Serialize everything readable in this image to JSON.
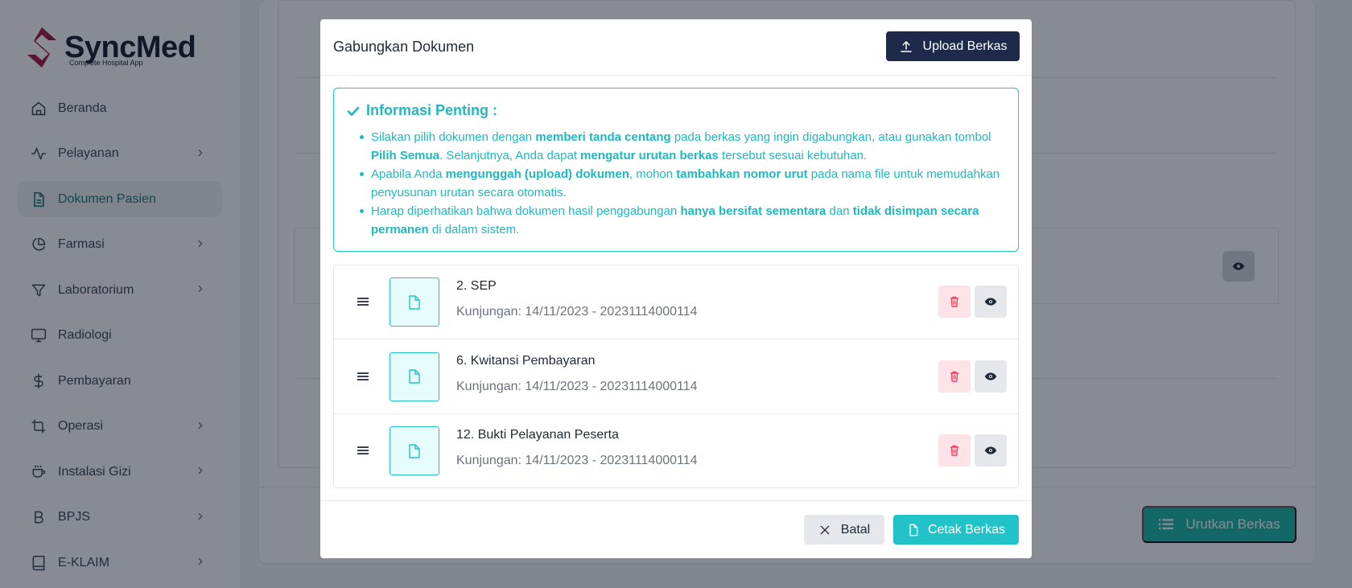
{
  "app": {
    "logo_name": "SyncMed",
    "logo_tagline": "Complete Hospital App"
  },
  "sidebar": {
    "items": [
      {
        "label": "Beranda",
        "icon": "home-icon",
        "has_children": false,
        "active": false
      },
      {
        "label": "Pelayanan",
        "icon": "activity-icon",
        "has_children": true,
        "active": false
      },
      {
        "label": "Dokumen Pasien",
        "icon": "document-icon",
        "has_children": false,
        "active": true
      },
      {
        "label": "Farmasi",
        "icon": "pie-chart-icon",
        "has_children": true,
        "active": false
      },
      {
        "label": "Laboratorium",
        "icon": "filter-icon",
        "has_children": true,
        "active": false
      },
      {
        "label": "Radiologi",
        "icon": "monitor-icon",
        "has_children": false,
        "active": false
      },
      {
        "label": "Pembayaran",
        "icon": "dollar-icon",
        "has_children": false,
        "active": false
      },
      {
        "label": "Operasi",
        "icon": "crop-icon",
        "has_children": true,
        "active": false
      },
      {
        "label": "Instalasi Gizi",
        "icon": "coffee-icon",
        "has_children": true,
        "active": false
      },
      {
        "label": "BPJS",
        "icon": "bold-b-icon",
        "has_children": true,
        "active": false
      },
      {
        "label": "E-KLAIM",
        "icon": "book-icon",
        "has_children": true,
        "active": false
      }
    ]
  },
  "background": {
    "sort_button_label": "Urutkan Berkas"
  },
  "modal": {
    "title": "Gabungkan Dokumen",
    "upload_label": "Upload Berkas",
    "info": {
      "title": "Informasi Penting :",
      "items": [
        [
          {
            "t": "Silakan pilih dokumen dengan ",
            "b": false
          },
          {
            "t": "memberi tanda centang",
            "b": true
          },
          {
            "t": " pada berkas yang ingin digabungkan, atau gunakan tombol ",
            "b": false
          },
          {
            "t": "Pilih Semua",
            "b": true
          },
          {
            "t": ". Selanjutnya, Anda dapat ",
            "b": false
          },
          {
            "t": "mengatur urutan berkas",
            "b": true
          },
          {
            "t": " tersebut sesuai kebutuhan.",
            "b": false
          }
        ],
        [
          {
            "t": "Apabila Anda ",
            "b": false
          },
          {
            "t": "mengunggah (upload) dokumen",
            "b": true
          },
          {
            "t": ", mohon ",
            "b": false
          },
          {
            "t": "tambahkan nomor urut",
            "b": true
          },
          {
            "t": " pada nama file untuk memudahkan penyusunan urutan secara otomatis.",
            "b": false
          }
        ],
        [
          {
            "t": "Harap diperhatikan bahwa dokumen hasil penggabungan ",
            "b": false
          },
          {
            "t": "hanya bersifat sementara",
            "b": true
          },
          {
            "t": " dan ",
            "b": false
          },
          {
            "t": "tidak disimpan secara permanen",
            "b": true
          },
          {
            "t": " di dalam sistem.",
            "b": false
          }
        ]
      ]
    },
    "documents": [
      {
        "title": "2. SEP",
        "subtitle": "Kunjungan: 14/11/2023 - 20231114000114"
      },
      {
        "title": "6. Kwitansi Pembayaran",
        "subtitle": "Kunjungan: 14/11/2023 - 20231114000114"
      },
      {
        "title": "12. Bukti Pelayanan Peserta",
        "subtitle": "Kunjungan: 14/11/2023 - 20231114000114"
      }
    ],
    "cancel_label": "Batal",
    "print_label": "Cetak Berkas"
  },
  "colors": {
    "accent": "#22c3c8",
    "navy": "#1e2a4a",
    "danger_bg": "#fde2e7",
    "danger": "#f43f5e",
    "brand_red": "#9f1239"
  }
}
